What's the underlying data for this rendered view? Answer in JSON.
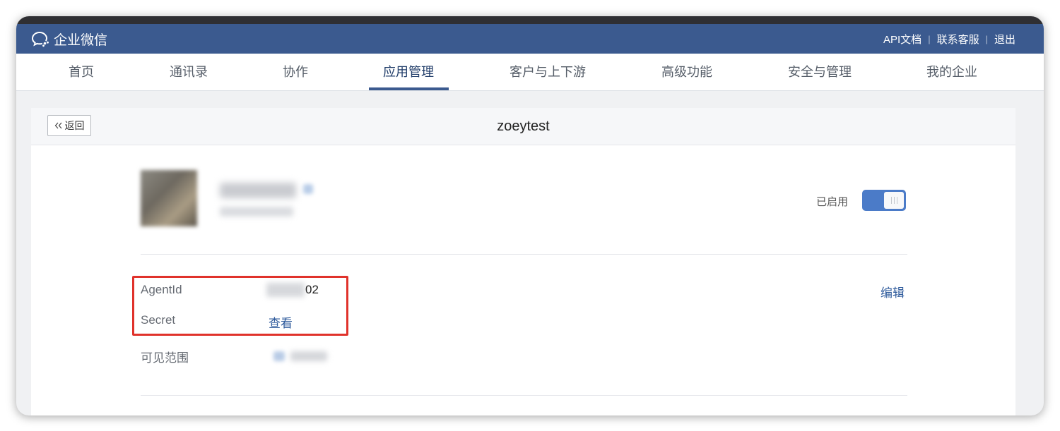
{
  "header": {
    "logo_text": "企业微信",
    "links": [
      "API文档",
      "联系客服",
      "退出"
    ],
    "separator": "|",
    "bg_color": "#3b5a8f"
  },
  "nav": {
    "items": [
      "首页",
      "通讯录",
      "协作",
      "应用管理",
      "客户与上下游",
      "高级功能",
      "安全与管理",
      "我的企业"
    ],
    "active_index": 3
  },
  "page": {
    "back_label": "返回",
    "title": "zoeytest"
  },
  "app": {
    "status_label": "已启用",
    "enabled": true
  },
  "fields": {
    "agentid_label": "AgentId",
    "agentid_value_visible": "02",
    "secret_label": "Secret",
    "secret_action": "查看",
    "scope_label": "可见范围",
    "edit_label": "编辑"
  },
  "colors": {
    "accent": "#3b5a8f",
    "toggle": "#4b7bc8",
    "highlight": "#e0322b",
    "link": "#2f5b9c"
  }
}
